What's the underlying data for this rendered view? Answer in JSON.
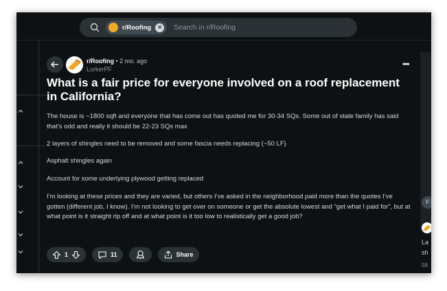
{
  "search": {
    "community_chip": "r/Roofing",
    "placeholder": "Search in r/Roofing"
  },
  "post": {
    "subreddit": "r/Roofing",
    "time": "• 2 mo. ago",
    "author": "LurkerPF",
    "title": "What is a fair price for everyone involved on a roof replacement in California?",
    "paragraphs": [
      "The house is ~1800 sqft and everyone that has come out has quoted me for 30-34 SQs. Some out of state family has said that’s odd and really it should be 22-23 SQs max",
      "2 layers of shingles need to be removed and some fascia needs replacing (~50 LF)",
      "Asphalt shingles again",
      "Account for some underlying plywood getting replaced",
      "I’m looking at these prices and they are varied, but others I’ve asked in the neighborhood paid more than the quotes I’ve gotten (different job, I know). I’m not looking to get over on someone or get the absolute lowest and “get what I paid for”, but at what point is it straight rip off and at what point is it too low to realistically get a good job?"
    ],
    "votes": "1",
    "comments": "11",
    "share": "Share",
    "more": "•••"
  },
  "right_panel": {
    "button_text": "F",
    "line1": "La",
    "line2": "sh",
    "line3": "58"
  },
  "colors": {
    "background": "#0e1113",
    "surface": "#2a3236",
    "brand": "#f5a623",
    "text": "#d7dadc"
  },
  "icons": [
    "search-icon",
    "community-icon",
    "clear-icon",
    "back-icon",
    "upvote-icon",
    "downvote-icon",
    "comment-icon",
    "award-icon",
    "share-icon",
    "more-icon",
    "chevron-icon"
  ]
}
